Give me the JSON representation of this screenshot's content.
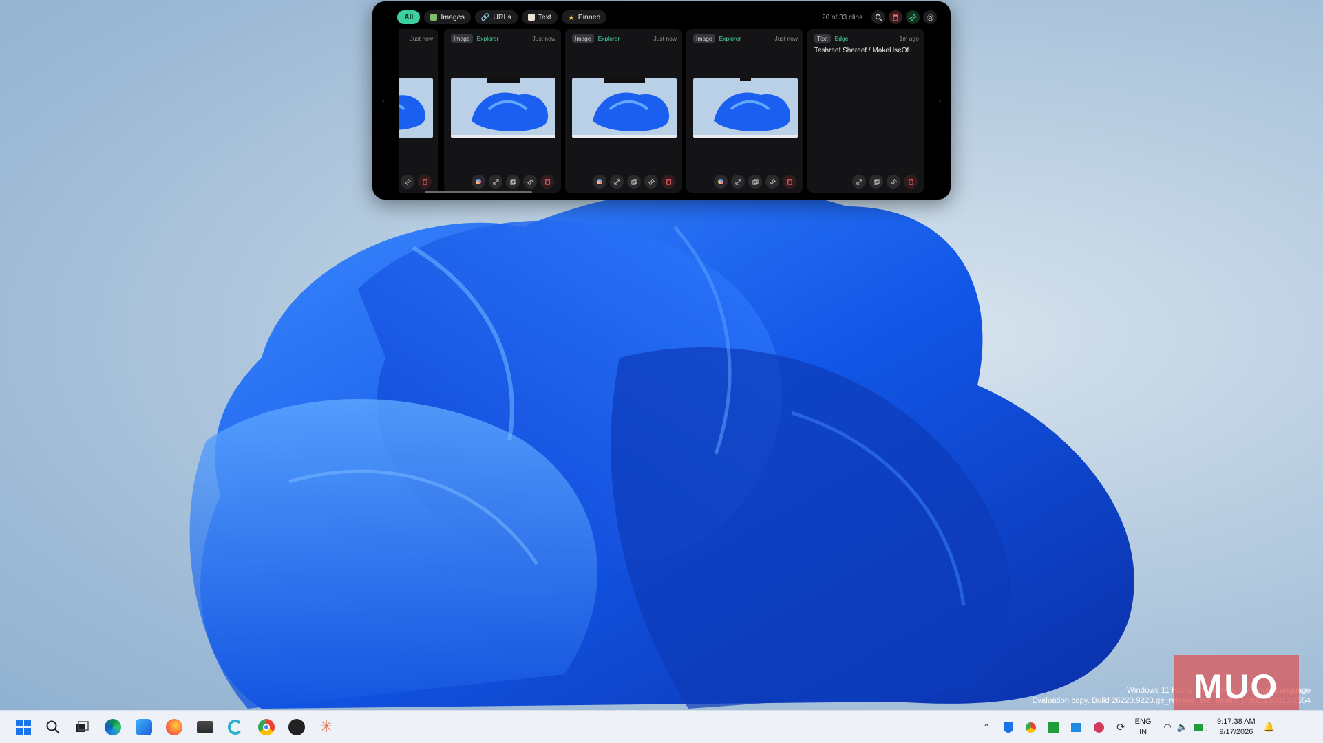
{
  "clipboard": {
    "filters": [
      {
        "label": "All",
        "active": true,
        "icon": "none"
      },
      {
        "label": "Images",
        "active": false,
        "icon": "image-icon"
      },
      {
        "label": "URLs",
        "active": false,
        "icon": "link-icon"
      },
      {
        "label": "Text",
        "active": false,
        "icon": "document-icon"
      },
      {
        "label": "Pinned",
        "active": false,
        "icon": "star-icon"
      }
    ],
    "count_label": "20 of 33 clips",
    "cards": [
      {
        "type": "",
        "source": "",
        "time": "Just now",
        "text": "",
        "has_image": true
      },
      {
        "type": "Image",
        "source": "Explorer",
        "time": "Just now",
        "text": "",
        "has_image": true
      },
      {
        "type": "Image",
        "source": "Explorer",
        "time": "Just now",
        "text": "",
        "has_image": true
      },
      {
        "type": "Image",
        "source": "Explorer",
        "time": "Just now",
        "text": "",
        "has_image": true
      },
      {
        "type": "Text",
        "source": "Edge",
        "time": "1m ago",
        "text": "Tashreef Shareef / MakeUseOf",
        "has_image": false
      }
    ]
  },
  "taskbar": {
    "language_top": "ENG",
    "language_bottom": "IN",
    "time": "9:17:38 AM",
    "date": "9/17/2026"
  },
  "watermark": {
    "line1": "Windows 11 Home Insider Preview Single Language",
    "line2": "Evaluation copy. Build 26220.9223.ge_release_svc_betaflt_prod1.260813-1554"
  },
  "logo_text": "MUO",
  "colors": {
    "accent": "#3ecfa0",
    "panel": "#000000",
    "card": "#141416"
  }
}
